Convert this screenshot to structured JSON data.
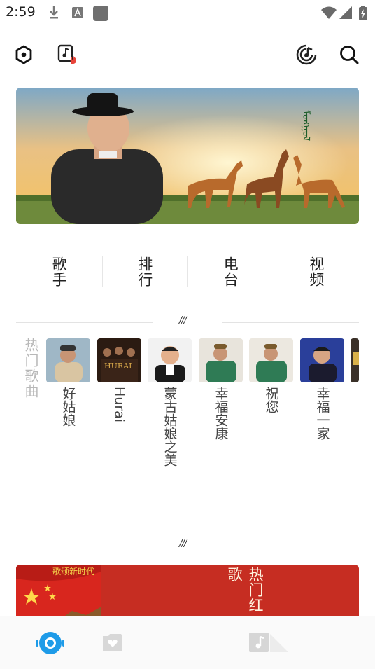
{
  "status_bar": {
    "time": "2:59"
  },
  "app_bar": {
    "icons": [
      "settings-icon",
      "hot-music-icon",
      "music-radar-icon",
      "search-icon"
    ]
  },
  "banner": {
    "script_text": "ᠮᠣᠩᠭᠣᠯ"
  },
  "categories": [
    {
      "label": "歌手",
      "icon": ""
    },
    {
      "label": "排行",
      "icon": ""
    },
    {
      "label": "电台",
      "icon": ""
    },
    {
      "label": "视频",
      "icon": ""
    }
  ],
  "divider_mark": "///",
  "hot_songs": {
    "title": "热门歌曲",
    "items": [
      {
        "title": "好姑娘"
      },
      {
        "title": "Hurai",
        "thumb_text": "HURAI"
      },
      {
        "title": "蒙古姑娘之美"
      },
      {
        "title": "幸福安康"
      },
      {
        "title": "祝您"
      },
      {
        "title": "幸福一家"
      }
    ]
  },
  "promo": {
    "title": "热门红歌",
    "subtitle": "歌颂新时代"
  },
  "bottom_nav": {
    "items": [
      "discover-icon",
      "favorites-icon",
      "player-music-icon"
    ]
  },
  "colors": {
    "accent": "#1e9be8",
    "promo_red": "#c62d22"
  }
}
